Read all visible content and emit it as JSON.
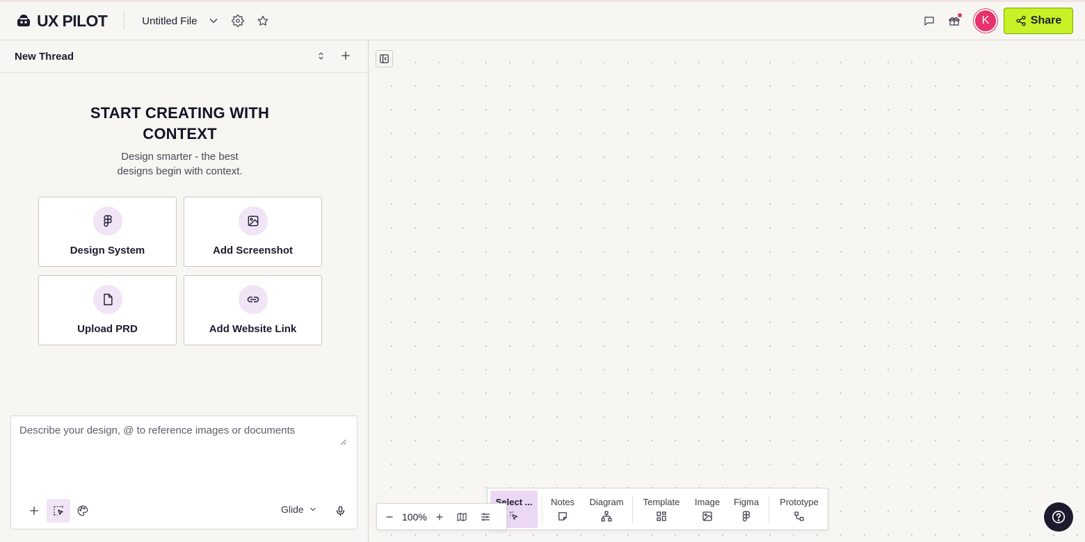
{
  "app": {
    "logo_text": "UX PILOT"
  },
  "header": {
    "file_title": "Untitled File",
    "avatar_initial": "K",
    "share_label": "Share",
    "share_color": "#c6f227",
    "avatar_color": "#e6336b"
  },
  "thread": {
    "title": "New Thread"
  },
  "hero": {
    "title_line1": "START CREATING WITH",
    "title_line2": "CONTEXT",
    "subtitle_line1": "Design smarter - the best",
    "subtitle_line2": "designs begin with context."
  },
  "cards": [
    {
      "label": "Design System",
      "icon": "figma-icon"
    },
    {
      "label": "Add Screenshot",
      "icon": "image-icon"
    },
    {
      "label": "Upload PRD",
      "icon": "document-icon"
    },
    {
      "label": "Add Website Link",
      "icon": "link-icon"
    }
  ],
  "prompt": {
    "placeholder": "Describe your design, @ to reference images or documents",
    "value": "",
    "model": "Glide"
  },
  "toolbar": {
    "items": [
      {
        "label": "Select ...",
        "icon": "select-cursor-icon",
        "active": true
      },
      {
        "label": "Notes",
        "icon": "sticky-note-icon"
      },
      {
        "label": "Diagram",
        "icon": "diagram-icon"
      },
      {
        "label": "Template",
        "icon": "template-grid-icon"
      },
      {
        "label": "Image",
        "icon": "image-icon"
      },
      {
        "label": "Figma",
        "icon": "figma-icon"
      },
      {
        "label": "Prototype",
        "icon": "prototype-icon"
      }
    ]
  },
  "zoom": {
    "value": "100%"
  },
  "colors": {
    "accent_lavender": "#f1e4f6",
    "dark": "#1c1b2e"
  }
}
